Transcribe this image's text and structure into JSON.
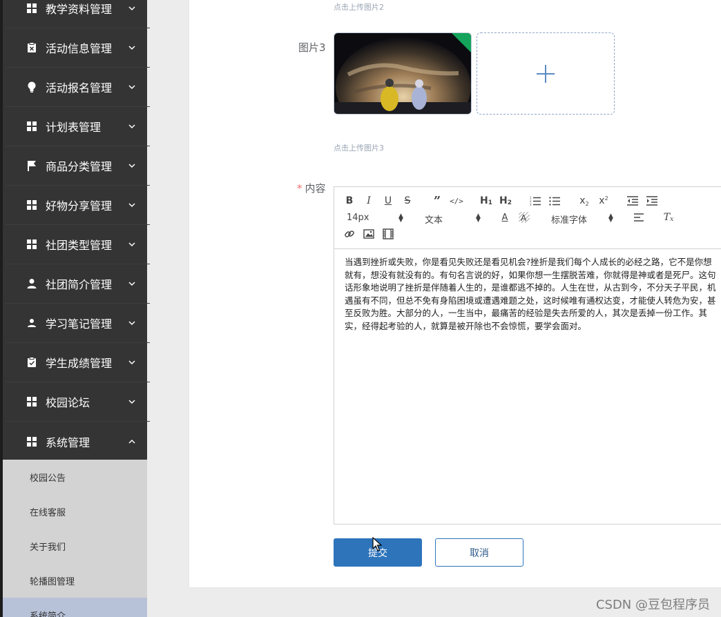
{
  "sidebar": {
    "items": [
      {
        "label": "教学资料管理",
        "icon": "grid-icon"
      },
      {
        "label": "活动信息管理",
        "icon": "clipboard-x-icon"
      },
      {
        "label": "活动报名管理",
        "icon": "bulb-icon"
      },
      {
        "label": "计划表管理",
        "icon": "grid-icon"
      },
      {
        "label": "商品分类管理",
        "icon": "flag-icon"
      },
      {
        "label": "好物分享管理",
        "icon": "grid-icon"
      },
      {
        "label": "社团类型管理",
        "icon": "grid-icon"
      },
      {
        "label": "社团简介管理",
        "icon": "user-icon"
      },
      {
        "label": "学习笔记管理",
        "icon": "user-icon"
      },
      {
        "label": "学生成绩管理",
        "icon": "clipboard-check-icon"
      },
      {
        "label": "校园论坛",
        "icon": "grid-icon"
      },
      {
        "label": "系统管理",
        "icon": "grid-icon"
      }
    ],
    "submenu": [
      {
        "label": "校园公告"
      },
      {
        "label": "在线客服"
      },
      {
        "label": "关于我们"
      },
      {
        "label": "轮播图管理"
      },
      {
        "label": "系统简介"
      }
    ]
  },
  "form": {
    "hint_image2": "点击上传图片2",
    "image3_label": "图片3",
    "hint_image3": "点击上传图片3",
    "content_label": "内容",
    "required_mark": "*",
    "editor": {
      "font_size": "14px",
      "text_style": "文本",
      "font_family": "标准字体",
      "lines": [
        "当遇到挫折或失败，你是看见失败还是看见机会?挫折是我们每个人成长的必经之路，它不是你想",
        "就有，想没有就没有的。有句名言说的好，如果你想一生摆脱苦难，你就得是神或者是死尸。这句",
        "话形象地说明了挫折是伴随着人生的，是谁都逃不掉的。人生在世，从古到今，不分天子平民，机",
        "遇虽有不同，但总不免有身陷困境或遭遇难题之处，这时候唯有通权达变，才能使人转危为安，甚",
        "至反败为胜。大部分的人，一生当中，最痛苦的经验是失去所爱的人，其次是丢掉一份工作。其",
        "实，经得起考验的人，就算是被开除也不会惊慌，要学会面对。"
      ]
    },
    "submit_label": "提交",
    "cancel_label": "取消"
  },
  "watermark": "CSDN @豆包程序员"
}
